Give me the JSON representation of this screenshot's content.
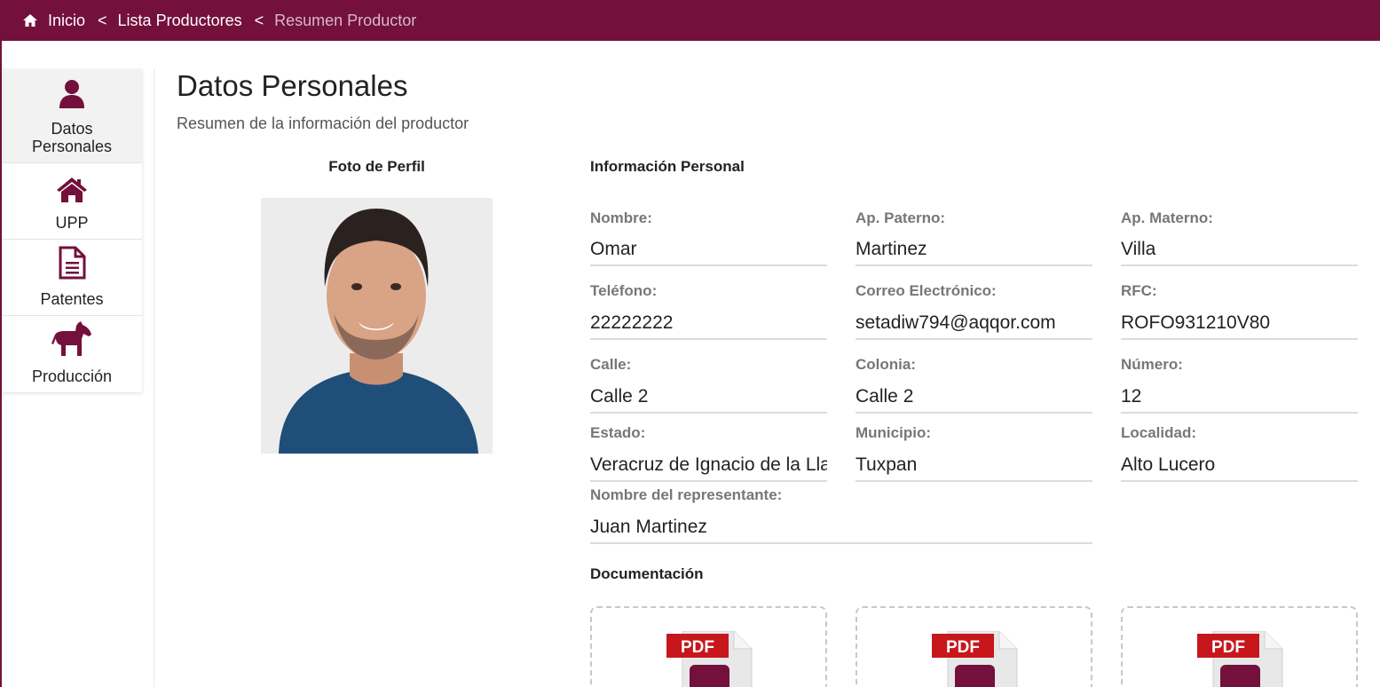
{
  "breadcrumb": {
    "home": "Inicio",
    "separator": "<",
    "list": "Lista Productores",
    "current": "Resumen Productor"
  },
  "sidebar": {
    "items": [
      {
        "label": "Datos Personales",
        "icon": "user-icon"
      },
      {
        "label": "UPP",
        "icon": "house-icon"
      },
      {
        "label": "Patentes",
        "icon": "document-icon"
      },
      {
        "label": "Producción",
        "icon": "horse-icon"
      }
    ]
  },
  "page": {
    "title": "Datos Personales",
    "subtitle": "Resumen de la información del productor"
  },
  "photo": {
    "title": "Foto de Perfil"
  },
  "info": {
    "title": "Información Personal",
    "nombre_label": "Nombre:",
    "nombre": "Omar",
    "paterno_label": "Ap. Paterno:",
    "paterno": "Martinez",
    "materno_label": "Ap. Materno:",
    "materno": "Villa",
    "telefono_label": "Teléfono:",
    "telefono": "22222222",
    "correo_label": "Correo Electrónico:",
    "correo": "setadiw794@aqqor.com",
    "rfc_label": "RFC:",
    "rfc": "ROFO931210V80",
    "calle_label": "Calle:",
    "calle": "Calle 2",
    "colonia_label": "Colonia:",
    "colonia": "Calle 2",
    "numero_label": "Número:",
    "numero": "12",
    "estado_label": "Estado:",
    "estado": "Veracruz de Ignacio de la Llave",
    "municipio_label": "Municipio:",
    "municipio": "Tuxpan",
    "localidad_label": "Localidad:",
    "localidad": "Alto Lucero",
    "representante_label": "Nombre del representante:",
    "representante": "Juan Martinez"
  },
  "docs": {
    "title": "Documentación",
    "pdf_text": "PDF"
  },
  "colors": {
    "brand": "#73103c",
    "pdf_red": "#c8161d"
  }
}
